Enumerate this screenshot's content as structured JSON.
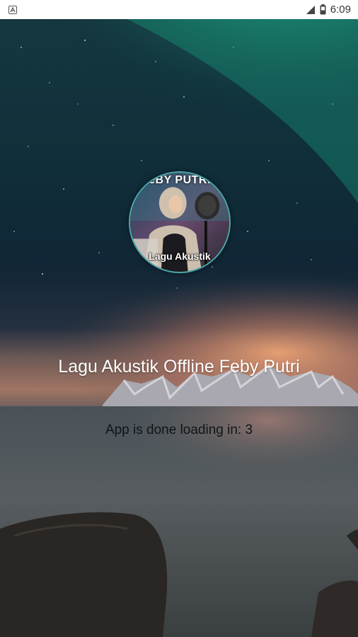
{
  "status_bar": {
    "time": "6:09",
    "icons": [
      "app-notification-icon",
      "signal-icon",
      "battery-icon"
    ]
  },
  "splash": {
    "cover_top_text": "eBY PUTRI",
    "cover_bottom_text": "Lagu Akustik",
    "title": "Lagu Akustik Offline Feby Putri",
    "loading_message": "App is done loading in: 3"
  },
  "colors": {
    "aurora": "#2fd0a0",
    "sky": "#0b2233",
    "sunset": "#f0a070",
    "water": "#4a5258"
  }
}
